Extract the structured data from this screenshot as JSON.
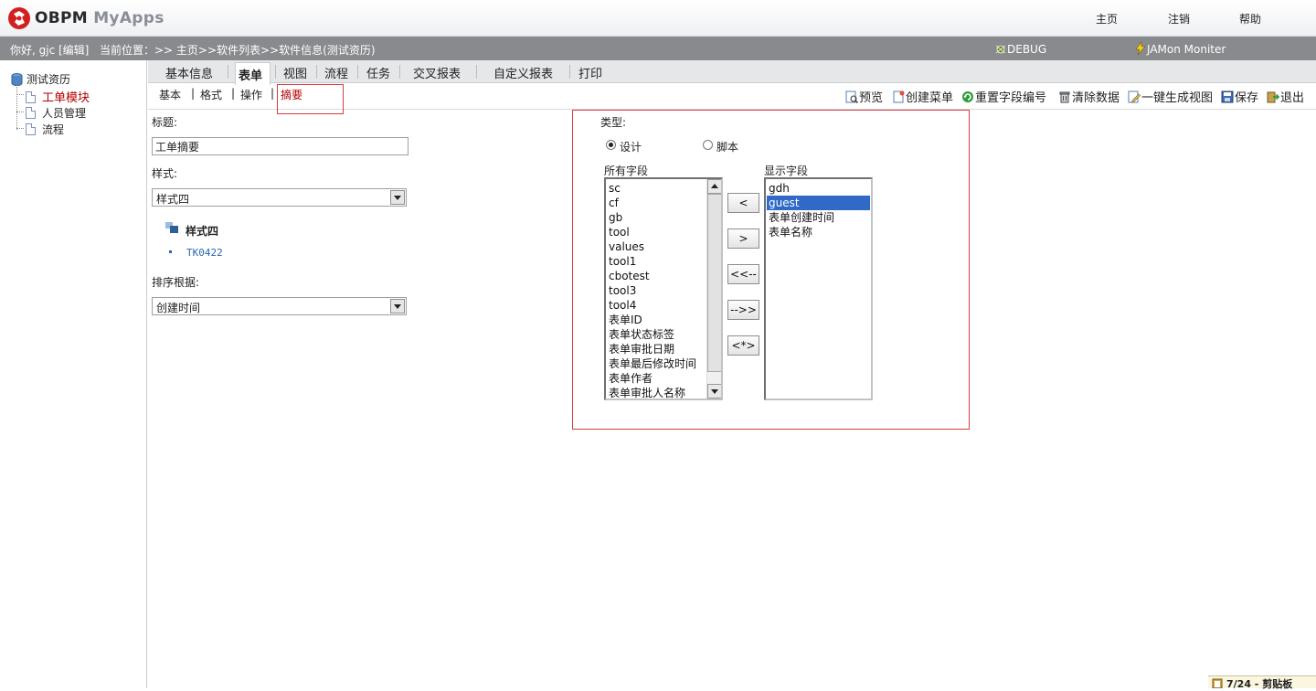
{
  "header": {
    "app_name_main": "OBPM",
    "app_name_sub": "MyApps",
    "links": [
      "主页",
      "注销",
      "帮助"
    ]
  },
  "infobar": {
    "greeting": "你好, gjc [编辑]",
    "location": "当前位置：>> 主页>>软件列表>>软件信息(测试资历)",
    "debug_label": "DEBUG",
    "jamon_label": "JAMon Moniter"
  },
  "tree": {
    "root": "测试资历",
    "children": [
      "工单模块",
      "人员管理",
      "流程"
    ],
    "active_index": 0
  },
  "tabs": [
    "基本信息",
    "表单",
    "视图",
    "流程",
    "任务",
    "交叉报表",
    "自定义报表",
    "打印"
  ],
  "active_tab": "表单",
  "subtabs": [
    "基本",
    "格式",
    "操作",
    "摘要"
  ],
  "active_subtab": "摘要",
  "toolbar": [
    "预览",
    "创建菜单",
    "重置字段编号",
    "清除数据",
    "一键生成视图",
    "保存",
    "退出"
  ],
  "form": {
    "title_label": "标题:",
    "title_value": "工单摘要",
    "style_label": "样式:",
    "style_value": "样式四",
    "preview_title": "样式四",
    "preview_item": "TK0422",
    "sort_label": "排序根据:",
    "sort_value": "创建时间"
  },
  "fields": {
    "type_label": "类型:",
    "type_options": [
      "设计",
      "脚本"
    ],
    "type_selected": "设计",
    "all_label": "所有字段",
    "all_items": [
      "sc",
      "cf",
      "gb",
      "tool",
      "values",
      "tool1",
      "cbotest",
      "tool3",
      "tool4",
      "表单ID",
      "表单状态标签",
      "表单审批日期",
      "表单最后修改时间",
      "表单作者",
      "表单审批人名称"
    ],
    "shown_label": "显示字段",
    "shown_items": [
      "gdh",
      "guest",
      "表单创建时间",
      "表单名称"
    ],
    "shown_selected": "guest",
    "buttons": [
      "<",
      ">",
      "<<--",
      "-->>",
      "<*>"
    ]
  },
  "status": {
    "text": "7/24 - 剪贴板"
  },
  "colors": {
    "highlight_border": "#d43d3d",
    "selection": "#3169c6",
    "active_tree_item": "#b00000",
    "infobar_bg": "#898a8e"
  }
}
